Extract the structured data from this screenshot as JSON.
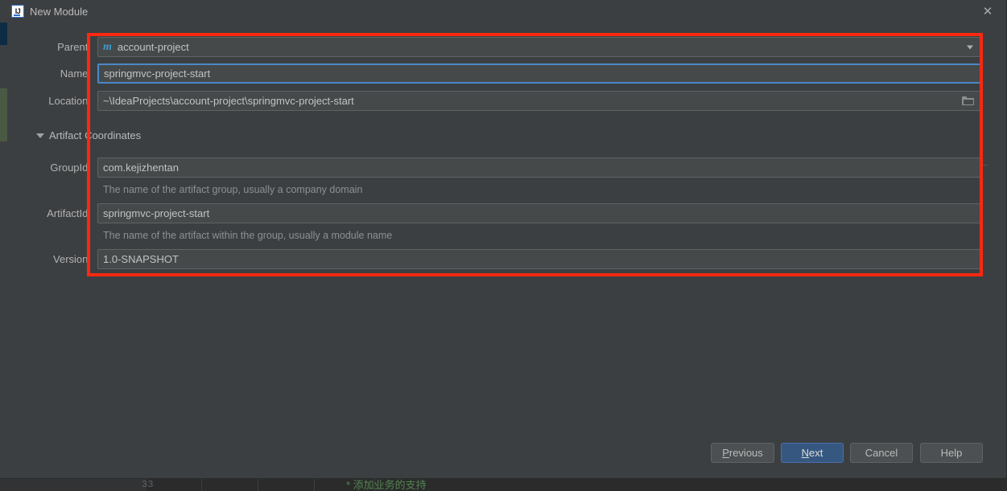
{
  "window": {
    "title": "New Module",
    "icon": "intellij-idea-icon",
    "close_label": "✕"
  },
  "form": {
    "rows": [
      {
        "label": "Parent:",
        "value": "account-project",
        "kind": "combo",
        "icon": "maven-module-icon"
      },
      {
        "label": "Name:",
        "value": "springmvc-project-start",
        "kind": "text",
        "focused": true
      },
      {
        "label": "Location:",
        "value": "~\\IdeaProjects\\account-project\\springmvc-project-start",
        "kind": "path",
        "icon": "folder-browse-icon"
      }
    ],
    "section": {
      "title": "Artifact Coordinates",
      "expanded": true,
      "toggle_icon": "triangle-down-icon"
    },
    "coordinates": [
      {
        "label": "GroupId:",
        "value": "com.kejizhentan",
        "hint": "The name of the artifact group, usually a company domain"
      },
      {
        "label": "ArtifactId:",
        "value": "springmvc-project-start",
        "hint": "The name of the artifact within the group, usually a module name"
      },
      {
        "label": "Version:",
        "value": "1.0-SNAPSHOT",
        "hint": ""
      }
    ]
  },
  "footer": {
    "buttons": [
      {
        "name": "previous",
        "label": "Previous",
        "mnemonic": "P",
        "primary": false
      },
      {
        "name": "next",
        "label": "Next",
        "mnemonic": "N",
        "primary": true
      },
      {
        "name": "cancel",
        "label": "Cancel",
        "mnemonic": "",
        "primary": false
      },
      {
        "name": "help",
        "label": "Help",
        "mnemonic": "",
        "primary": false
      }
    ]
  },
  "background": {
    "editor_line_number": "33",
    "editor_comment": "* 添加业务的支持"
  },
  "annotation": {
    "shape": "rectangle",
    "color": "#fc2810",
    "covers": "all form fields from Parent through Version"
  },
  "colors": {
    "dialog_background": "#3c3f41",
    "field_background": "#45494a",
    "focus_border": "#4a88c7",
    "primary_button": "#365880",
    "annotation_red": "#fc2810",
    "maven_icon_blue": "#3c9dd0",
    "comment_green": "#548450"
  }
}
